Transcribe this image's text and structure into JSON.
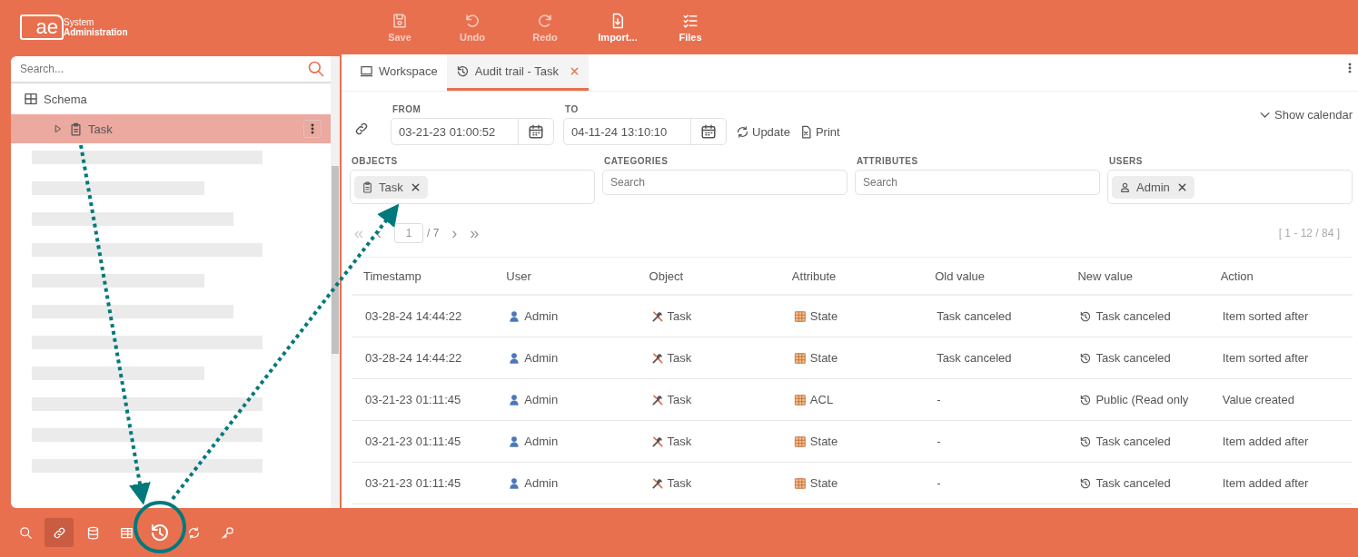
{
  "header": {
    "logo": {
      "mark": "ae",
      "line1": "System",
      "line2": "Administration"
    },
    "toolbar": [
      {
        "kind": "save",
        "label": "Save",
        "disabled": true
      },
      {
        "kind": "undo",
        "label": "Undo",
        "disabled": true
      },
      {
        "kind": "redo",
        "label": "Redo",
        "disabled": true
      },
      {
        "kind": "import",
        "label": "Import...",
        "disabled": false
      },
      {
        "kind": "files",
        "label": "Files",
        "disabled": false
      }
    ]
  },
  "sidebar": {
    "search": {
      "placeholder": "Search..."
    },
    "tree": [
      {
        "label": "Schema",
        "kind": "schema",
        "selected": false,
        "children": [
          {
            "label": "Task",
            "kind": "object",
            "selected": true
          }
        ]
      }
    ]
  },
  "bottom_toolbar": [
    {
      "kind": "search",
      "selected": false
    },
    {
      "kind": "link",
      "selected": true
    },
    {
      "kind": "database",
      "selected": false
    },
    {
      "kind": "table",
      "selected": false
    },
    {
      "kind": "history",
      "selected": false
    },
    {
      "kind": "refresh",
      "selected": false
    },
    {
      "kind": "key",
      "selected": false
    }
  ],
  "tabs": [
    {
      "label": "Workspace",
      "kind": "workspace",
      "selected": false,
      "closable": false
    },
    {
      "label": "Audit trail - Task",
      "kind": "audit",
      "selected": true,
      "closable": true
    }
  ],
  "range": {
    "from": {
      "label": "FROM",
      "value": "03-21-23 01:00:52"
    },
    "to": {
      "label": "TO",
      "value": "04-11-24 13:10:10"
    }
  },
  "actions": [
    {
      "kind": "refresh",
      "label": "Update"
    },
    {
      "kind": "print",
      "label": "Print"
    }
  ],
  "show_calendar": "Show calendar",
  "filters": [
    {
      "label": "OBJECTS",
      "chips": [
        {
          "kind": "object",
          "label": "Task"
        }
      ]
    },
    {
      "label": "CATEGORIES",
      "placeholder": "Search"
    },
    {
      "label": "ATTRIBUTES",
      "placeholder": "Search"
    },
    {
      "label": "USERS",
      "chips": [
        {
          "kind": "user",
          "label": "Admin"
        }
      ]
    }
  ],
  "pagination": {
    "first": "«",
    "previous": "‹",
    "page": "1",
    "total": "/ 7",
    "next": "›",
    "last": "»",
    "range": "[ 1 - 12 / 84 ]"
  },
  "table": {
    "columns": [
      {
        "label": "Timestamp",
        "kind": "text"
      },
      {
        "label": "User",
        "kind": "user"
      },
      {
        "label": "Object",
        "kind": "object"
      },
      {
        "label": "Attribute",
        "kind": "attribute"
      },
      {
        "label": "Old value",
        "kind": "text"
      },
      {
        "label": "New value",
        "kind": "history"
      },
      {
        "label": "Action",
        "kind": "text"
      }
    ],
    "rows": [
      [
        "03-28-24 14:44:22",
        "Admin",
        "Task",
        "State",
        "Task canceled",
        "Task canceled",
        "Item sorted after"
      ],
      [
        "03-28-24 14:44:22",
        "Admin",
        "Task",
        "State",
        "Task canceled",
        "Task canceled",
        "Item sorted after"
      ],
      [
        "03-21-23 01:11:45",
        "Admin",
        "Task",
        "ACL",
        "-",
        "Public (Read only",
        "Value created"
      ],
      [
        "03-21-23 01:11:45",
        "Admin",
        "Task",
        "State",
        "-",
        "Task canceled",
        "Item added after"
      ],
      [
        "03-21-23 01:11:45",
        "Admin",
        "Task",
        "State",
        "-",
        "Task canceled",
        "Item added after"
      ]
    ]
  }
}
